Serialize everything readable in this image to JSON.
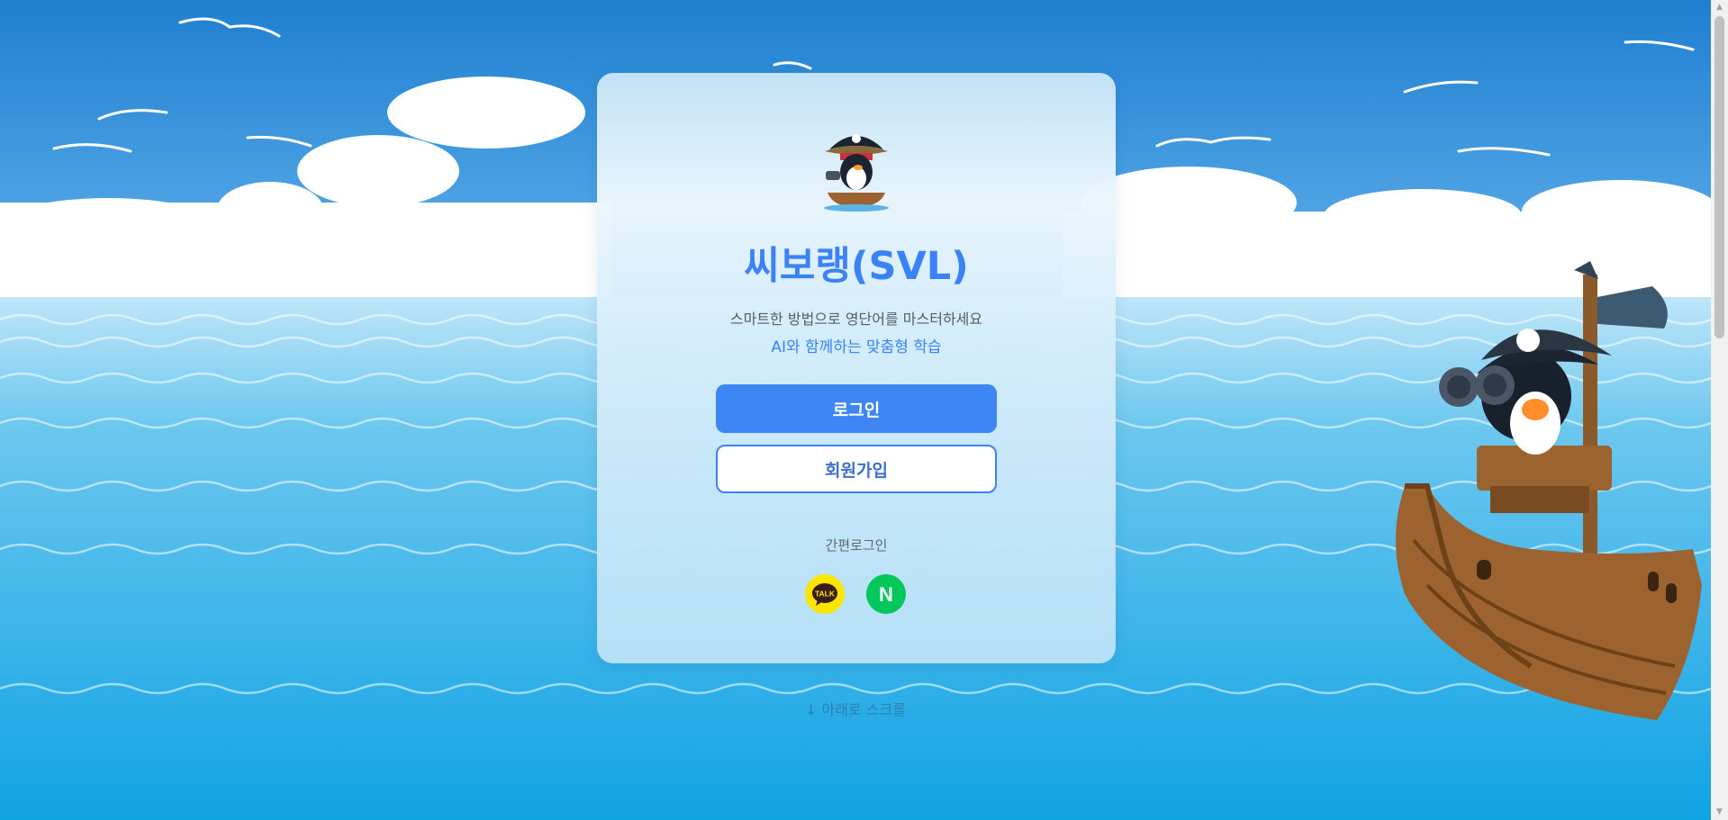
{
  "app": {
    "title": "씨보랭(SVL)",
    "subtitle": "스마트한 방법으로 영단어를 마스터하세요",
    "tagline": "AI와 함께하는 맞춤형 학습"
  },
  "auth": {
    "login_label": "로그인",
    "signup_label": "회원가입",
    "easy_login_label": "간편로그인",
    "kakao_text": "TALK",
    "naver_text": "N"
  },
  "scroll_hint": "↓ 아래로 스크롤",
  "icons": {
    "mascot": "pirate-penguin-in-boat-icon",
    "decoration": "pirate-penguin-ship-illustration",
    "kakao": "kakao-talk-icon",
    "naver": "naver-icon"
  },
  "colors": {
    "accent": "#3b82f6",
    "kakao": "#fee500",
    "naver": "#03c75a"
  }
}
